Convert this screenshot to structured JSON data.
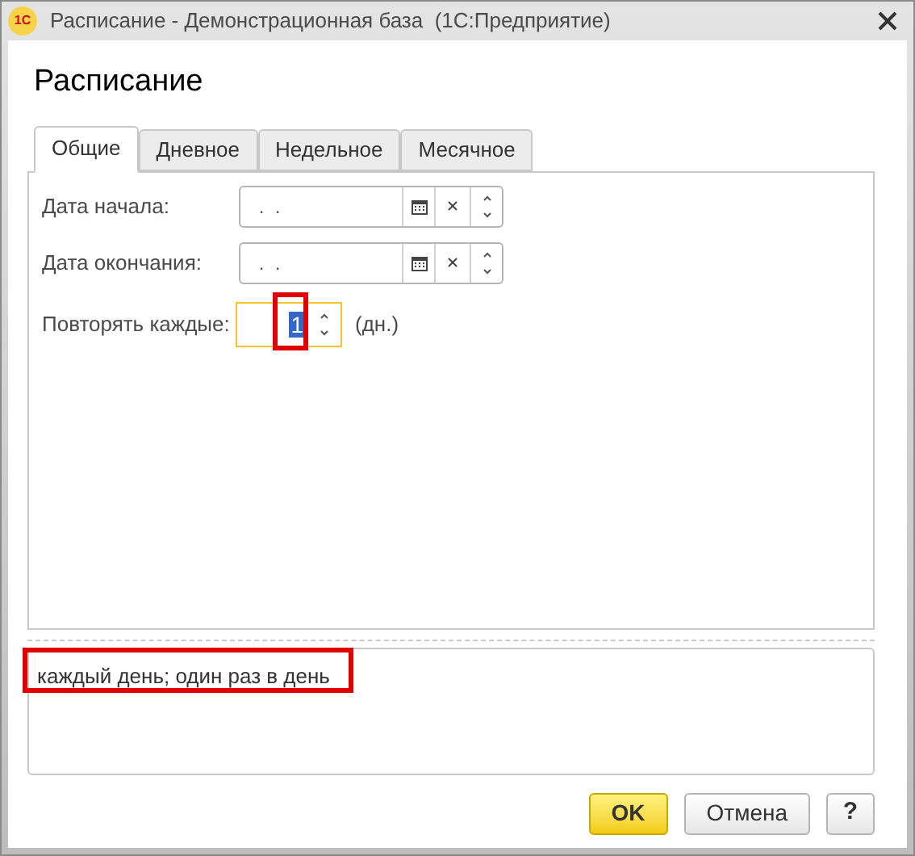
{
  "window": {
    "title": "Расписание - Демонстрационная база  (1С:Предприятие)",
    "logo": "1С"
  },
  "form_title": "Расписание",
  "tabs": [
    {
      "label": "Общие",
      "selected": true
    },
    {
      "label": "Дневное",
      "selected": false
    },
    {
      "label": "Недельное",
      "selected": false
    },
    {
      "label": "Месячное",
      "selected": false
    }
  ],
  "fields": [
    {
      "kind": "date",
      "label": "Дата начала:",
      "value": " .  ."
    },
    {
      "kind": "date",
      "label": "Дата окончания:",
      "value": " .  ."
    },
    {
      "kind": "number",
      "label": "Повторять каждые:",
      "value": "1",
      "unit": "(дн.)",
      "focused": true,
      "highlighted": true
    }
  ],
  "summary": {
    "text": "каждый день; один раз в день",
    "highlighted": true
  },
  "buttons": [
    {
      "label": "OK",
      "kind": "default"
    },
    {
      "label": "Отмена",
      "kind": "normal"
    },
    {
      "label": "?",
      "kind": "help"
    }
  ]
}
